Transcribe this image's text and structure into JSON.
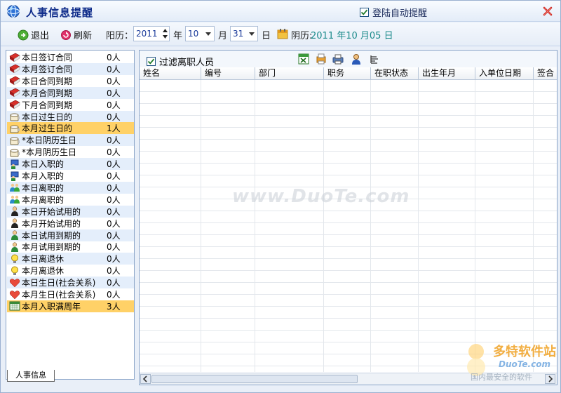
{
  "app": {
    "title": "人事信息提醒",
    "auto_login_label": "登陆自动提醒",
    "auto_login_checked": true
  },
  "toolbar": {
    "exit_label": "退出",
    "refresh_label": "刷新",
    "solar_label": "阳历：",
    "year_value": "2011",
    "year_unit": "年",
    "month_value": "10",
    "month_unit": "月",
    "day_value": "31",
    "day_unit": "日",
    "lunar_label": "阴历:",
    "lunar_value": "2011 年10 月05 日"
  },
  "sidebar": {
    "items": [
      {
        "label": "本日签订合同",
        "count": "0人",
        "icon": "contract-book-icon"
      },
      {
        "label": "本月签订合同",
        "count": "0人",
        "icon": "contract-book-icon"
      },
      {
        "label": "本日合同到期",
        "count": "0人",
        "icon": "contract-book-icon"
      },
      {
        "label": "本月合同到期",
        "count": "0人",
        "icon": "contract-book-icon"
      },
      {
        "label": "下月合同到期",
        "count": "0人",
        "icon": "contract-book-icon"
      },
      {
        "label": "本日过生日的",
        "count": "0人",
        "icon": "cake-icon"
      },
      {
        "label": "本月过生日的",
        "count": "1人",
        "icon": "cake-icon"
      },
      {
        "label": "*本日阴历生日",
        "count": "0人",
        "icon": "cake-icon"
      },
      {
        "label": "*本月阴历生日",
        "count": "0人",
        "icon": "cake-icon"
      },
      {
        "label": "本日入职的",
        "count": "0人",
        "icon": "person-join-icon"
      },
      {
        "label": "本月入职的",
        "count": "0人",
        "icon": "person-join-icon"
      },
      {
        "label": "本日离职的",
        "count": "0人",
        "icon": "people-leave-icon"
      },
      {
        "label": "本月离职的",
        "count": "0人",
        "icon": "people-leave-icon"
      },
      {
        "label": "本日开始试用的",
        "count": "0人",
        "icon": "person-trial-icon"
      },
      {
        "label": "本月开始试用的",
        "count": "0人",
        "icon": "person-trial-icon"
      },
      {
        "label": "本日试用到期的",
        "count": "0人",
        "icon": "person-trial-end-icon"
      },
      {
        "label": "本月试用到期的",
        "count": "0人",
        "icon": "person-trial-end-icon"
      },
      {
        "label": "本日离退休",
        "count": "0人",
        "icon": "bulb-icon"
      },
      {
        "label": "本月离退休",
        "count": "0人",
        "icon": "bulb-icon"
      },
      {
        "label": "本日生日(社会关系)",
        "count": "0人",
        "icon": "heart-icon"
      },
      {
        "label": "本月生日(社会关系)",
        "count": "0人",
        "icon": "heart-icon"
      },
      {
        "label": "本月入职满周年",
        "count": "3人",
        "icon": "calendar-icon"
      }
    ],
    "highlighted_indices": [
      6,
      21
    ],
    "tab_label": "人事信息"
  },
  "main": {
    "filter_label": "过滤离职人员",
    "filter_checked": true,
    "action_icons": [
      "excel-export-icon",
      "print-preview-icon",
      "printer-icon",
      "person-detail-icon",
      "column-settings-icon"
    ],
    "columns": [
      "姓名",
      "编号",
      "部门",
      "职务",
      "在职状态",
      "出生年月",
      "入单位日期",
      "签合"
    ]
  },
  "watermark": {
    "center_text": "www.DuoTe.com",
    "brand_cn": "多特软件站",
    "brand_en": "DuoTe.com",
    "slogan": "国内最安全的软件"
  },
  "colors": {
    "title": "#0f2c8a",
    "highlight_row": "#ffd167",
    "alt_row": "#e4eefb",
    "lunar_text": "#1a8a8a"
  }
}
